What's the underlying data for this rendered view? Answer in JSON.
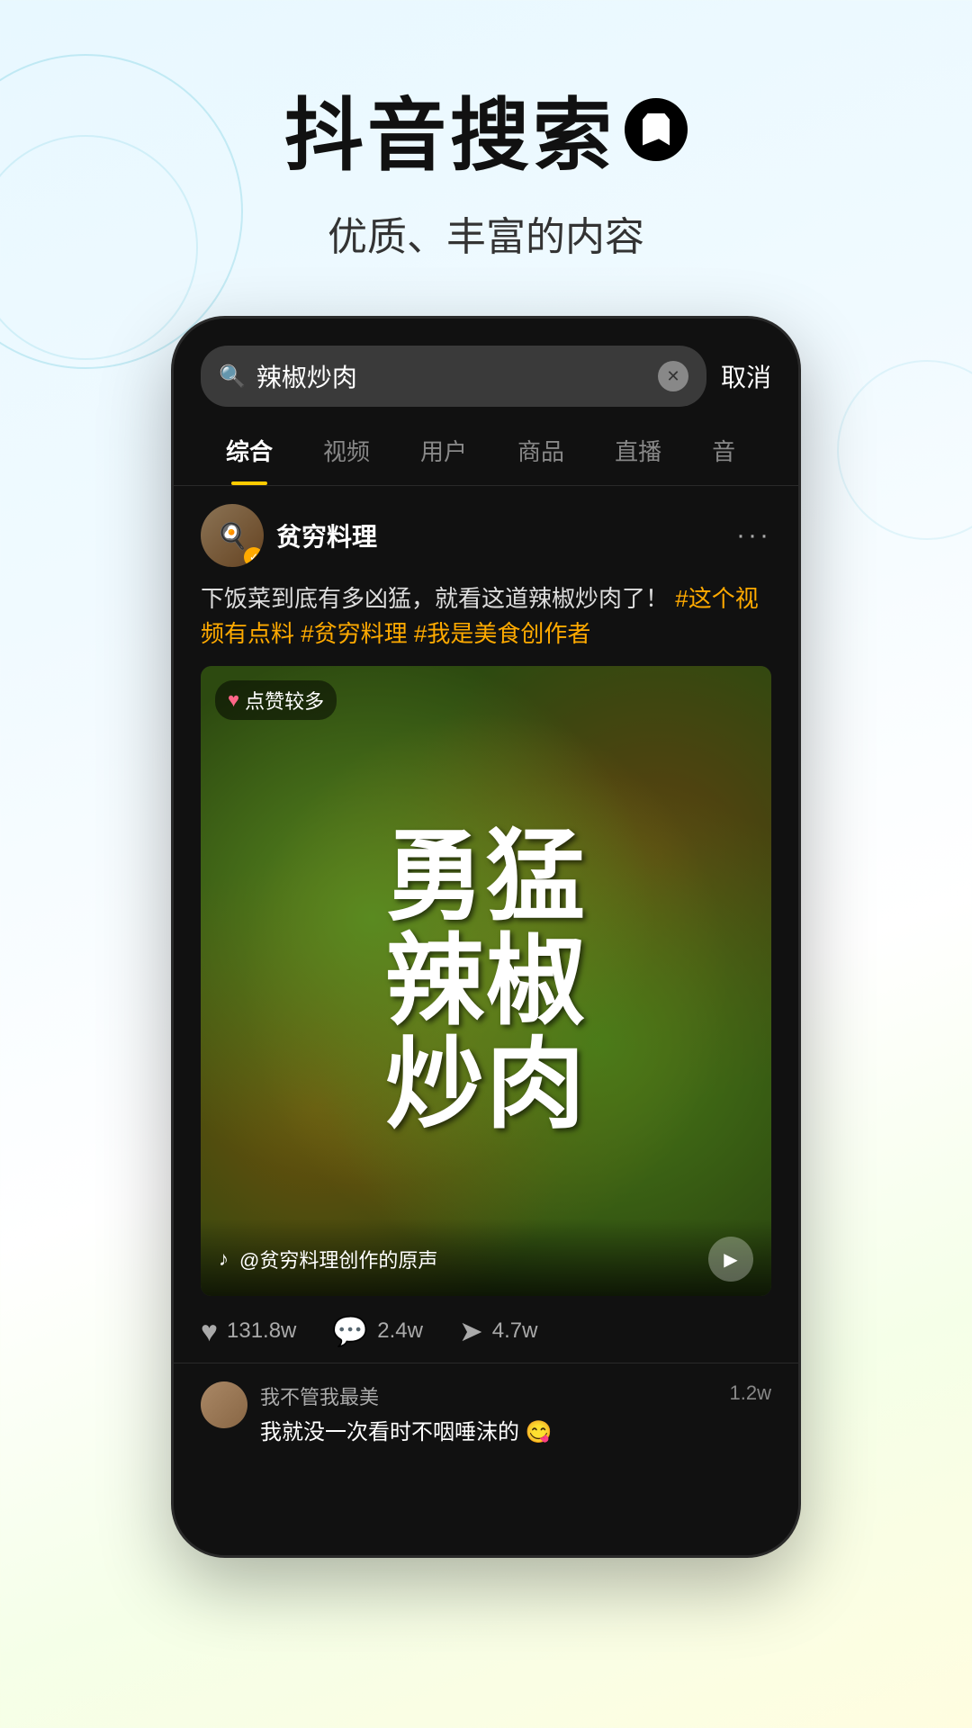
{
  "header": {
    "main_title": "抖音搜索",
    "subtitle": "优质、丰富的内容"
  },
  "phone": {
    "search": {
      "query": "辣椒炒肉",
      "cancel_label": "取消"
    },
    "tabs": [
      {
        "label": "综合",
        "active": true
      },
      {
        "label": "视频",
        "active": false
      },
      {
        "label": "用户",
        "active": false
      },
      {
        "label": "商品",
        "active": false
      },
      {
        "label": "直播",
        "active": false
      },
      {
        "label": "音",
        "active": false
      }
    ],
    "post": {
      "author_name": "贫穷料理",
      "description": "下饭菜到底有多凶猛，就看这道辣椒炒肉了！",
      "hashtags": [
        "#这个视频有点料",
        "#贫穷料理",
        "#我是美食创作者"
      ],
      "video_badge": "点赞较多",
      "food_text_lines": [
        "勇",
        "猛",
        "辣",
        "椒炒",
        "肉"
      ],
      "audio_text": "@贫穷料理创作的原声",
      "likes": "131.8w",
      "comments": "2.4w",
      "shares": "4.7w"
    },
    "comments": [
      {
        "user": "我不管我最美",
        "text": "我就没一次看时不咽唾沫的 😋"
      },
      {
        "count": "1.2w"
      }
    ]
  },
  "icons": {
    "search": "🔍",
    "clear": "✕",
    "more": "···",
    "heart": "♡",
    "heart_filled": "♥",
    "comment": "💬",
    "share": "➤",
    "play": "▶",
    "music": "♪",
    "verified": "✓"
  }
}
